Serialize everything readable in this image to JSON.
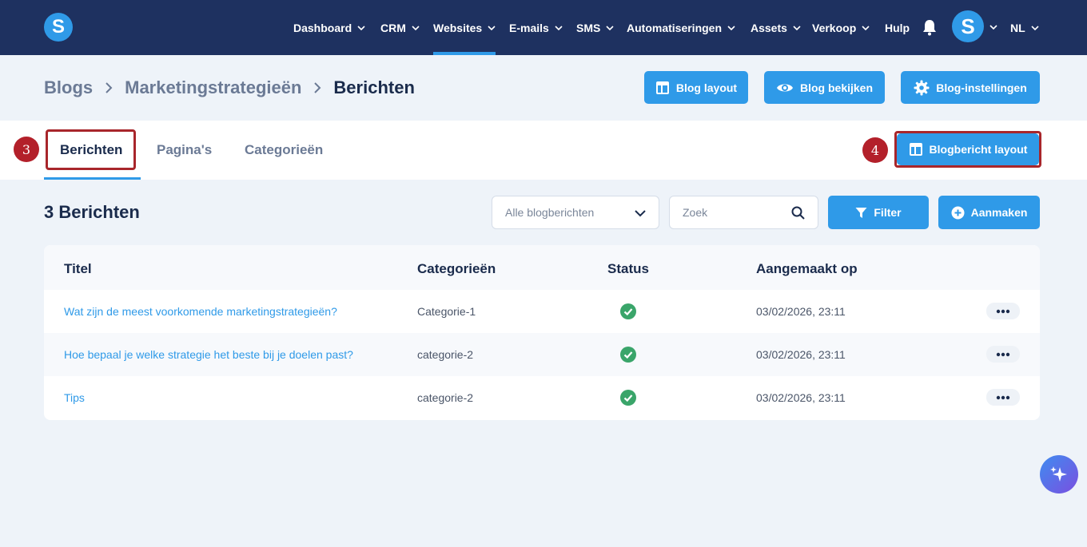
{
  "nav": {
    "items": [
      {
        "label": "Dashboard",
        "has_dropdown": true
      },
      {
        "label": "CRM",
        "has_dropdown": true
      },
      {
        "label": "Websites",
        "has_dropdown": true,
        "active": true
      },
      {
        "label": "E-mails",
        "has_dropdown": true
      },
      {
        "label": "SMS",
        "has_dropdown": true
      },
      {
        "label": "Automatiseringen",
        "has_dropdown": true
      },
      {
        "label": "Assets",
        "has_dropdown": true
      },
      {
        "label": "Verkoop",
        "has_dropdown": true
      },
      {
        "label": "Hulp",
        "has_dropdown": false
      }
    ],
    "logo_letter": "S",
    "avatar_letter": "S",
    "language": "NL",
    "icons": {
      "notification": "bell-icon",
      "dropdown": "chevron-down-icon"
    }
  },
  "breadcrumb": {
    "items": [
      "Blogs",
      "Marketingstrategieën"
    ],
    "current": "Berichten"
  },
  "header_buttons": {
    "blog_layout": "Blog layout",
    "blog_view": "Blog bekijken",
    "blog_settings": "Blog-instellingen"
  },
  "tabs": {
    "items": [
      "Berichten",
      "Pagina's",
      "Categorieën"
    ],
    "active_index": 0,
    "post_layout_button": "Blogbericht layout"
  },
  "annotations": {
    "step_tabs": "3",
    "step_post_layout": "4"
  },
  "list": {
    "count_title": "3 Berichten",
    "filter_select": "Alle blogberichten",
    "search_placeholder": "Zoek",
    "filter_button": "Filter",
    "create_button": "Aanmaken"
  },
  "table": {
    "columns": [
      "Titel",
      "Categorieën",
      "Status",
      "Aangemaakt op"
    ],
    "rows": [
      {
        "title": "Wat zijn de meest voorkomende marketingstrategieën?",
        "category": "Categorie-1",
        "status": "published",
        "created": "03/02/2026, 23:11"
      },
      {
        "title": "Hoe bepaal je welke strategie het beste bij je doelen past?",
        "category": "categorie-2",
        "status": "published",
        "created": "03/02/2026, 23:11"
      },
      {
        "title": "Tips",
        "category": "categorie-2",
        "status": "published",
        "created": "03/02/2026, 23:11"
      }
    ]
  },
  "colors": {
    "nav_bg": "#1e3160",
    "accent": "#2f9ae8",
    "status_ok": "#3aa56a",
    "annotation": "#b3202a"
  }
}
